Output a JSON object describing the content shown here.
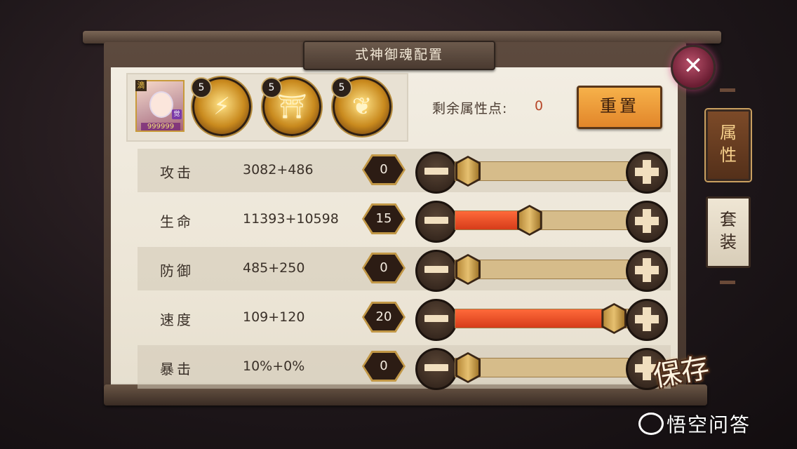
{
  "title": "式神御魂配置",
  "close_icon": "close-icon",
  "equipment": {
    "portrait_rank": "滴",
    "portrait_level": "999999",
    "portrait_badge": "觉",
    "souls": [
      {
        "star": "5",
        "icon": "flame-claw-icon"
      },
      {
        "star": "5",
        "icon": "torii-gate-icon"
      },
      {
        "star": "5",
        "icon": "wheat-icon"
      }
    ]
  },
  "remaining_label": "剩余属性点:",
  "remaining_value": "0",
  "reset_label": "重置",
  "tabs": [
    "属性",
    "套装"
  ],
  "stats": [
    {
      "name": "攻击",
      "value": "3082+486",
      "points": "0",
      "fill": 0.0
    },
    {
      "name": "生命",
      "value": "11393+10598",
      "points": "15",
      "fill": 0.43
    },
    {
      "name": "防御",
      "value": "485+250",
      "points": "0",
      "fill": 0.0
    },
    {
      "name": "速度",
      "value": "109+120",
      "points": "20",
      "fill": 0.92
    },
    {
      "name": "暴击",
      "value": "10%+0%",
      "points": "0",
      "fill": 0.0
    }
  ],
  "save_label": "保存",
  "watermark": "悟空问答",
  "colors": {
    "accent": "#e2862a",
    "fill": "#d63c1a",
    "close": "#6a1d32"
  }
}
